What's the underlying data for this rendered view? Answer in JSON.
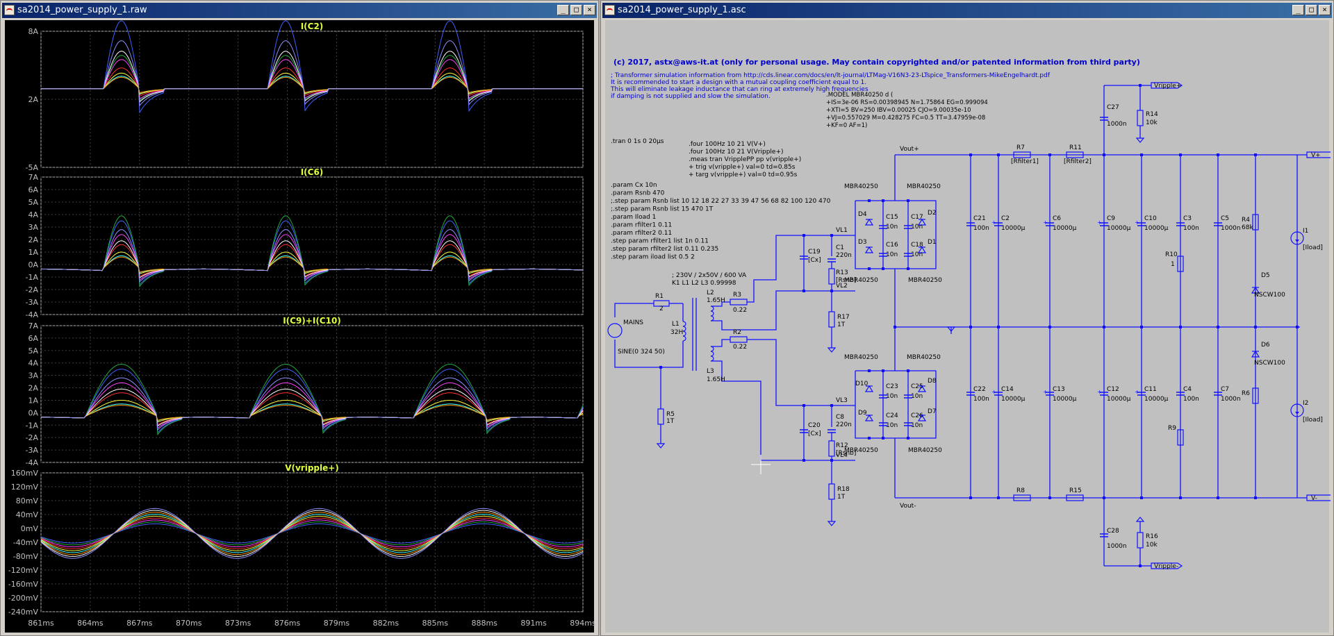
{
  "plot_window": {
    "title": "sa2014_power_supply_1.raw",
    "panes": [
      {
        "label": "I(C2)",
        "y_ticks": [
          "8A",
          "2A",
          "-5A"
        ]
      },
      {
        "label": "I(C6)",
        "y_ticks": [
          "7A",
          "6A",
          "5A",
          "4A",
          "3A",
          "2A",
          "1A",
          "0A",
          "-1A",
          "-2A",
          "-3A",
          "-4A"
        ]
      },
      {
        "label": "I(C9)+I(C10)",
        "y_ticks": [
          "7A",
          "6A",
          "5A",
          "4A",
          "3A",
          "2A",
          "1A",
          "0A",
          "-1A",
          "-2A",
          "-3A",
          "-4A"
        ]
      },
      {
        "label": "V(vripple+)",
        "y_ticks": [
          "160mV",
          "120mV",
          "80mV",
          "40mV",
          "0mV",
          "-40mV",
          "-80mV",
          "-120mV",
          "-160mV",
          "-200mV",
          "-240mV"
        ]
      }
    ],
    "x_ticks": [
      "861ms",
      "864ms",
      "867ms",
      "870ms",
      "873ms",
      "876ms",
      "879ms",
      "882ms",
      "885ms",
      "888ms",
      "891ms",
      "894ms"
    ],
    "trace_colors": [
      "#4060ff",
      "#22aa44",
      "#ff40ff",
      "#ff3030",
      "#ffff40",
      "#40ffff",
      "#ff9900",
      "#ffffff",
      "#9090ff"
    ]
  },
  "schematic_window": {
    "title": "sa2014_power_supply_1.asc",
    "copyright": "(c) 2017, astx@aws-it.at (only for personal usage. May contain copyrighted and/or patented information from third party)",
    "comment_lines": [
      "; Transformer simulation information from http://cds.linear.com/docs/en/lt-journal/LTMag-V16N3-23-LTspice_Transformers-MikeEngelhardt.pdf",
      "It is recommended to start a design with a mutual coupling coefficient equal to 1.",
      "This will eliminate leakage inductance that can ring at extremely high frequencies",
      "if damping is not supplied and slow the simulation."
    ],
    "model_lines": [
      ".MODEL MBR40250 d (",
      "+IS=3e-06 RS=0.00398945 N=1.75864 EG=0.999094",
      "+XTI=5 BV=250 IBV=0.00025 CJO=9.00035e-10",
      "+VJ=0.557029 M=0.428275 FC=0.5 TT=3.47959e-08",
      "+KF=0 AF=1)"
    ],
    "tran": ".tran 0 1s 0 20µs",
    "meas_lines": [
      ".four 100Hz 10 21 V(V+)",
      ".four 100Hz 10 21 V(Vripple+)",
      ".meas tran VripplePP pp v(vripple+)",
      "+ trig v(vripple+) val=0 td=0.85s",
      "+ targ v(vripple+)  val=0 td=0.95s"
    ],
    "param_lines": [
      ".param Cx 10n",
      ".param Rsnb 470",
      ";.step param Rsnb list 10 12 18 22 27 33 39 47 56 68 82 100 120 470",
      ";.step param Rsnb list 15 470 1T",
      ".param Iload 1",
      ".param rfilter1 0.11",
      ".param rfilter2 0.11",
      ".step param rfilter1 list 1n 0.11",
      ".step param rfilter2 list 0.11 0.235",
      ".step param iload list 0.5 2"
    ],
    "transformer_lines": [
      "; 230V / 2x50V / 600 VA",
      "K1 L1 L2  L3 0.99998"
    ],
    "components": {
      "mains": "MAINS",
      "mains_value": "SINE(0 324 50)",
      "r1": "R1",
      "r1_value": "2",
      "l1": "L1",
      "l1_value": "32H",
      "l2": "L2",
      "l2_value": "1.65H",
      "l3": "L3",
      "l3_value": "1.65H",
      "r3": "R3",
      "r3_value": "0.22",
      "r2": "R2",
      "r2_value": "0.22",
      "r5": "R5",
      "r5_value": "1T",
      "r17": "R17",
      "r17_value": "1T",
      "r18": "R18",
      "r18_value": "1T",
      "c19": "C19",
      "c19_value": "[Cx]",
      "c20": "C20",
      "c20_value": "[Cx]",
      "c1": "C1",
      "c1_value": "220n",
      "c8": "C8",
      "c8_value": "220n",
      "r13": "R13",
      "r13_value": "[Rsnb]",
      "r12": "R12",
      "r12_value": "[Rsnb]",
      "vl1": "VL1",
      "vl2": "VL2",
      "vl3": "VL3",
      "vl4": "VL4",
      "diode_model": "MBR40250",
      "d1": "D1",
      "d2": "D2",
      "d3": "D3",
      "d4": "D4",
      "d7": "D7",
      "d8": "D8",
      "d9": "D9",
      "d10": "D10",
      "c15": "C15",
      "c16": "C16",
      "c17": "C17",
      "c18": "C18",
      "c23": "C23",
      "c24": "C24",
      "c25": "C25",
      "c26": "C26",
      "small_cap_value": "10n",
      "vout_plus": "Vout+",
      "vout_minus": "Vout-",
      "c21": "C21",
      "c22": "C22",
      "c21_value": "100n",
      "c2": "C2",
      "c14": "C14",
      "c6": "C6",
      "c13": "C13",
      "c9": "C9",
      "c12": "C12",
      "c10": "C10",
      "c11": "C11",
      "big_cap_value": "10000µ",
      "c3": "C3",
      "c4": "C4",
      "c5": "C5",
      "c7": "C7",
      "c27": "C27",
      "c28": "C28",
      "k1_value": "1000n",
      "r7": "R7",
      "r8": "R8",
      "r7_value": "[Rfilter1]",
      "r11": "R11",
      "r15": "R15",
      "r11_value": "[Rfilter2]",
      "r14": "R14",
      "r16": "R16",
      "r14_value": "10k",
      "r10": "R10",
      "r9": "R9",
      "r10_value": "1",
      "r4": "R4",
      "r6": "R6",
      "r4_value": "68k",
      "d5": "D5",
      "d6": "D6",
      "led_model": "NSCW100",
      "i1": "I1",
      "i2": "I2",
      "iload": "[Iload]",
      "vplus": "V+",
      "vminus": "V-",
      "vripple_plus": "Vripple+",
      "vripple_minus": "Vripple-"
    }
  }
}
